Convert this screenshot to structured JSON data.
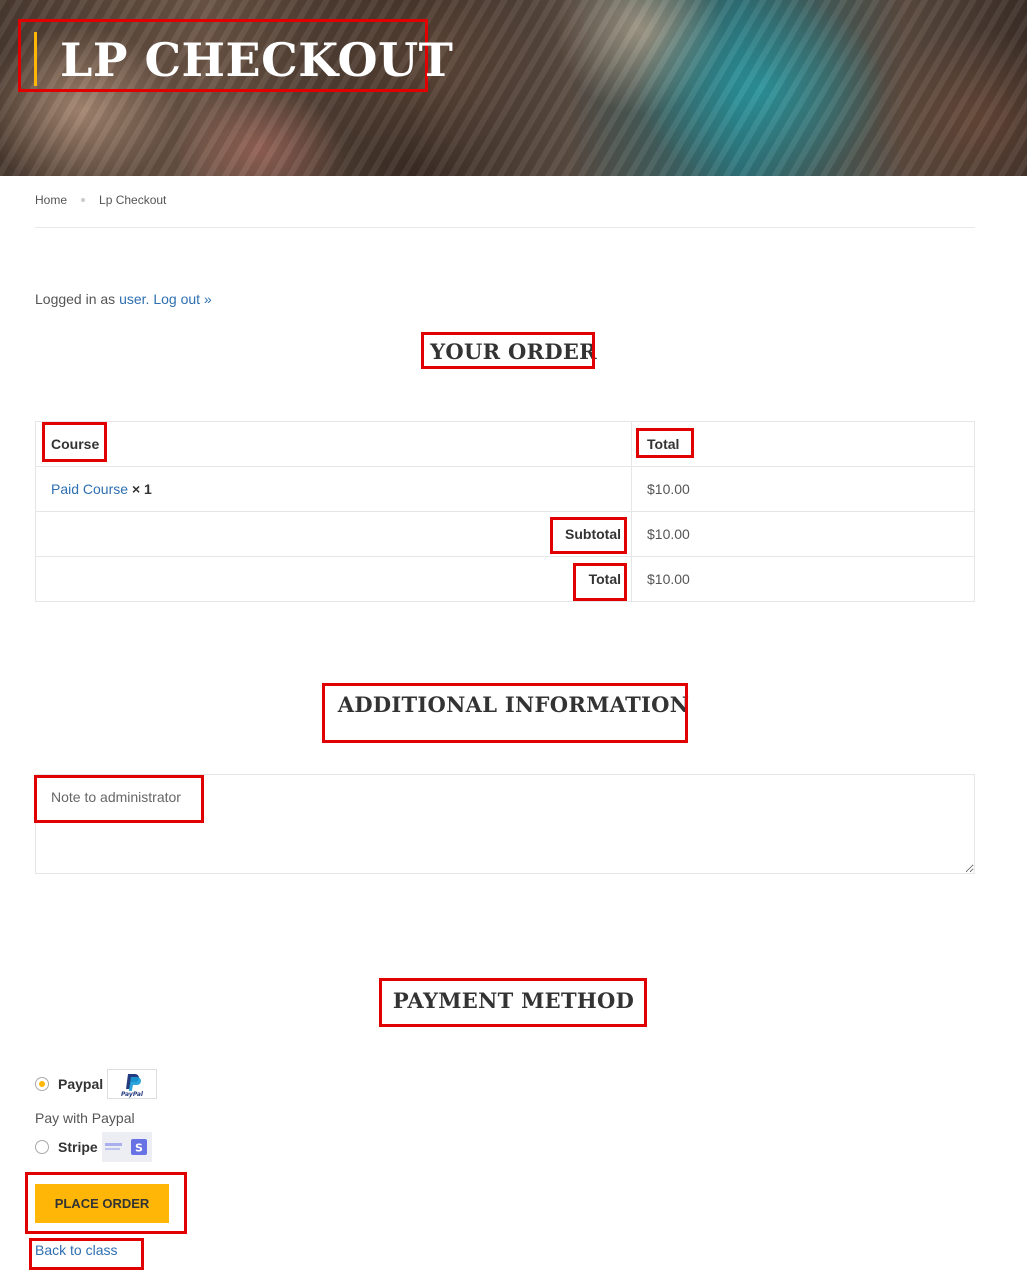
{
  "hero": {
    "title": "LP CHECKOUT"
  },
  "breadcrumb": {
    "home": "Home",
    "current": "Lp Checkout"
  },
  "account": {
    "logged_prefix": "Logged in as ",
    "user": "user.",
    "logout": "Log out »"
  },
  "order": {
    "heading": "YOUR ORDER",
    "headers": {
      "course": "Course",
      "total": "Total"
    },
    "item": {
      "name": "Paid Course",
      "qty": "× 1",
      "price": "$10.00"
    },
    "subtotal": {
      "label": "Subtotal",
      "value": "$10.00"
    },
    "total": {
      "label": "Total",
      "value": "$10.00"
    }
  },
  "additional": {
    "heading": "ADDITIONAL INFORMATION",
    "note_placeholder": "Note to administrator"
  },
  "payment": {
    "heading": "PAYMENT METHOD",
    "methods": [
      {
        "label": "Paypal",
        "selected": true,
        "icon": "paypal-logo",
        "description": "Pay with Paypal"
      },
      {
        "label": "Stripe",
        "selected": false,
        "icon": "stripe-logo"
      }
    ],
    "place_order": "PLACE ORDER",
    "back_link": "Back to class"
  },
  "colors": {
    "accent": "#ffb606",
    "link": "#2e6fb2",
    "annotation": "#e00000"
  }
}
